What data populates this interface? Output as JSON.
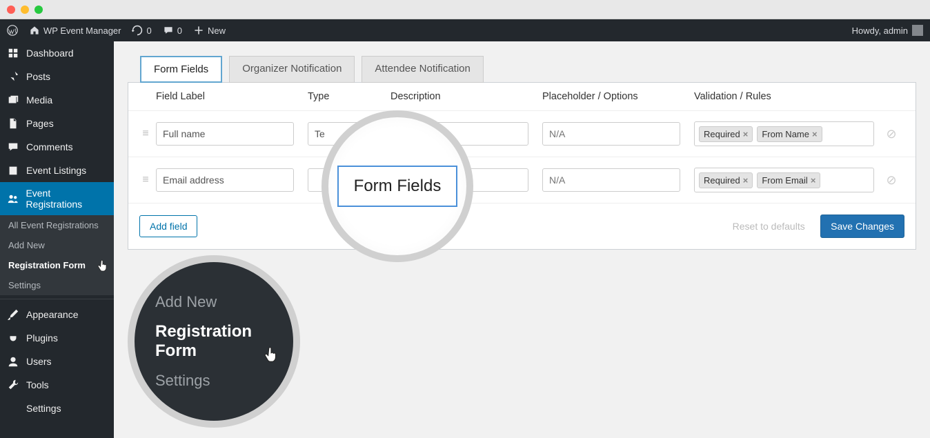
{
  "adminbar": {
    "site_name": "WP Event Manager",
    "updates": "0",
    "comments": "0",
    "new": "New",
    "howdy": "Howdy, admin"
  },
  "sidebar": {
    "items": [
      {
        "label": "Dashboard"
      },
      {
        "label": "Posts"
      },
      {
        "label": "Media"
      },
      {
        "label": "Pages"
      },
      {
        "label": "Comments"
      },
      {
        "label": "Event Listings"
      },
      {
        "label": "Event Registrations"
      }
    ],
    "subitems": [
      {
        "label": "All Event Registrations"
      },
      {
        "label": "Add New"
      },
      {
        "label": "Registration Form"
      },
      {
        "label": "Settings"
      }
    ],
    "bottom": [
      {
        "label": "Appearance"
      },
      {
        "label": "Plugins"
      },
      {
        "label": "Users"
      },
      {
        "label": "Tools"
      },
      {
        "label": "Settings"
      }
    ]
  },
  "tabs": [
    {
      "label": "Form Fields"
    },
    {
      "label": "Organizer Notification"
    },
    {
      "label": "Attendee Notification"
    }
  ],
  "columns": {
    "c1": "Field Label",
    "c2": "Type",
    "c3": "Description",
    "c4": "Placeholder / Options",
    "c5": "Validation / Rules"
  },
  "rows": [
    {
      "label": "Full name",
      "type": "Te",
      "desc": "",
      "placeholder": "N/A",
      "tags": [
        "Required",
        "From Name"
      ]
    },
    {
      "label": "Email address",
      "type": "",
      "desc": "",
      "placeholder": "N/A",
      "tags": [
        "Required",
        "From Email"
      ]
    }
  ],
  "actions": {
    "add": "Add field",
    "reset": "Reset to defaults",
    "save": "Save Changes"
  },
  "mag1": "Form Fields",
  "mag2": {
    "a": "Add New",
    "b": "Registration Form",
    "c": "Settings"
  }
}
